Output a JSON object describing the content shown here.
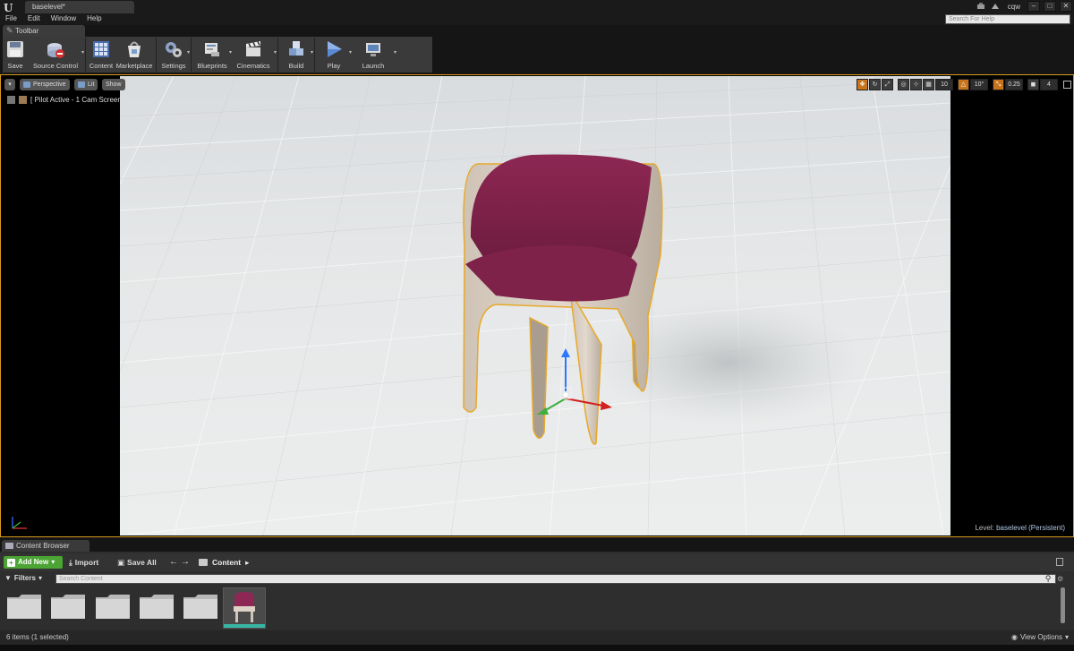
{
  "window": {
    "doc_tab": "baselevel*",
    "user": "cqw",
    "search_help_placeholder": "Search For Help",
    "win_min": "–",
    "win_max": "□",
    "win_close": "✕"
  },
  "menu": [
    "File",
    "Edit",
    "Window",
    "Help"
  ],
  "toolbar": {
    "tab_label": "Toolbar",
    "buttons": [
      {
        "label": "Save",
        "icon": "save-icon"
      },
      {
        "label": "Source Control",
        "icon": "source-control-icon"
      },
      {
        "label": "Content",
        "icon": "content-icon"
      },
      {
        "label": "Marketplace",
        "icon": "marketplace-icon"
      },
      {
        "label": "Settings",
        "icon": "settings-icon"
      },
      {
        "label": "Blueprints",
        "icon": "blueprints-icon"
      },
      {
        "label": "Cinematics",
        "icon": "cinematics-icon"
      },
      {
        "label": "Build",
        "icon": "build-icon"
      },
      {
        "label": "Play",
        "icon": "play-icon"
      },
      {
        "label": "Launch",
        "icon": "launch-icon"
      }
    ]
  },
  "viewport": {
    "perspective": "Perspective",
    "lit": "Lit",
    "show": "Show",
    "pilot_text": "[ Pilot Active - 1 Cam Screen ]",
    "grid_snap": "10",
    "rotation_snap": "10°",
    "scale_snap": "0.25",
    "camera_speed": "4",
    "level_key": "Level:",
    "level_value": "baselevel (Persistent)"
  },
  "content_browser": {
    "tab_label": "Content Browser",
    "add_new": "Add New",
    "import": "Import",
    "save_all": "Save All",
    "breadcrumb": "Content",
    "filters": "Filters",
    "search_placeholder": "Search Content",
    "items_status": "6 items (1 selected)",
    "view_options": "View Options"
  },
  "colors": {
    "accent_orange": "#c8741c",
    "selection_outline": "#e7a92a",
    "add_new_green": "#4ba433",
    "chair_seat": "#7a1f45",
    "chair_shell": "#d8ccbf"
  }
}
